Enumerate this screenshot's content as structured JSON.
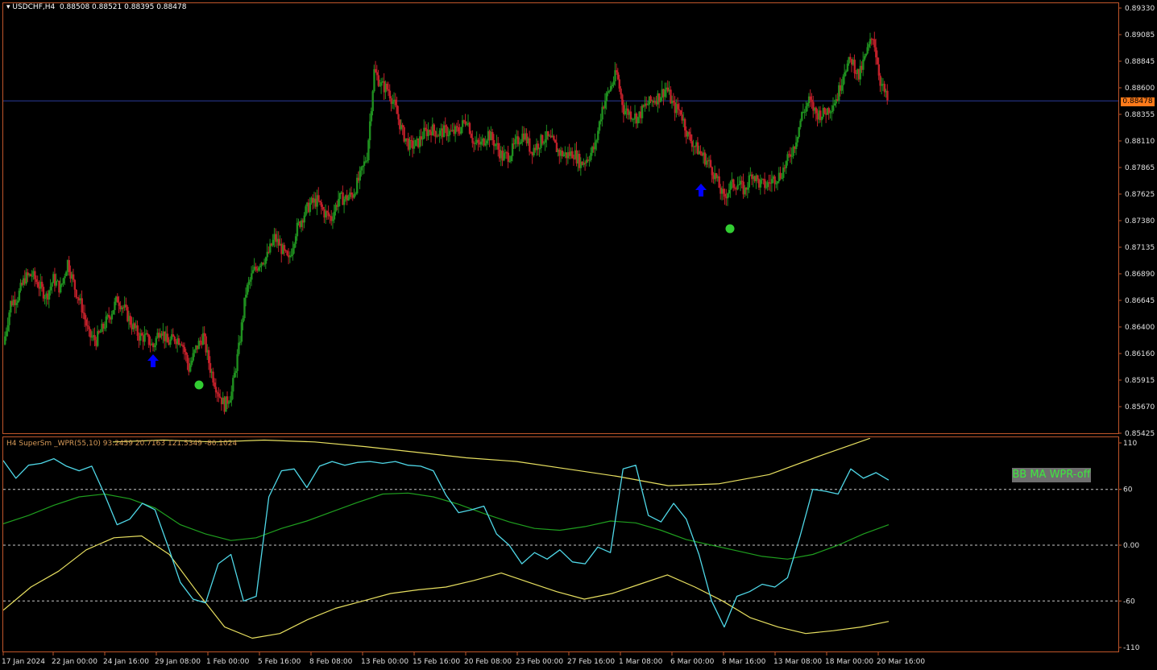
{
  "chart": {
    "symbol_tf": "USDCHF,H4",
    "ohlc": "0.88508 0.88521 0.88395 0.88478",
    "current_price": "0.88478",
    "y_ticks": [
      "0.89330",
      "0.89085",
      "0.88845",
      "0.88600",
      "0.88355",
      "0.88110",
      "0.87865",
      "0.87625",
      "0.87380",
      "0.87135",
      "0.86890",
      "0.86645",
      "0.86400",
      "0.86160",
      "0.85915",
      "0.85670",
      "0.85425"
    ],
    "up_color": "#1f8f1f",
    "down_color": "#c0202a",
    "arrow_color": "#0000ff",
    "dot_color": "#32cd32"
  },
  "indicator": {
    "title": "H4 SuperSm _WPR(55,10) 93.2459 20.7163 121.5349 -80.1024",
    "y_labels": [
      "110",
      "60",
      "0.00",
      "-60",
      "-110"
    ],
    "button_label": "BB MA WPR-off",
    "colors": {
      "wpr": "#4fd8e8",
      "ma": "#1f9f1f",
      "bands": "#e8e060"
    }
  },
  "x_axis": {
    "labels": [
      "17 Jan 2024",
      "22 Jan 00:00",
      "24 Jan 16:00",
      "29 Jan 08:00",
      "1 Feb 00:00",
      "5 Feb 16:00",
      "8 Feb 08:00",
      "13 Feb 00:00",
      "15 Feb 16:00",
      "20 Feb 08:00",
      "23 Feb 00:00",
      "27 Feb 16:00",
      "1 Mar 08:00",
      "6 Mar 00:00",
      "8 Mar 16:00",
      "13 Mar 08:00",
      "18 Mar 00:00",
      "20 Mar 16:00"
    ]
  },
  "chart_data": {
    "type": "candlestick",
    "price_path": [
      0.8624,
      0.8662,
      0.8668,
      0.8685,
      0.8688,
      0.8678,
      0.8668,
      0.8684,
      0.8675,
      0.87,
      0.8676,
      0.8658,
      0.8632,
      0.8628,
      0.864,
      0.8652,
      0.8666,
      0.8656,
      0.8642,
      0.8632,
      0.863,
      0.8622,
      0.864,
      0.8625,
      0.863,
      0.8628,
      0.8602,
      0.862,
      0.8632,
      0.8602,
      0.8582,
      0.8568,
      0.858,
      0.862,
      0.8672,
      0.869,
      0.87,
      0.8705,
      0.8722,
      0.8712,
      0.87,
      0.8728,
      0.8742,
      0.8753,
      0.8756,
      0.8745,
      0.874,
      0.8758,
      0.8758,
      0.8762,
      0.8778,
      0.8798,
      0.8875,
      0.8862,
      0.8858,
      0.884,
      0.8818,
      0.8806,
      0.8808,
      0.8818,
      0.8822,
      0.8818,
      0.882,
      0.8818,
      0.8822,
      0.8832,
      0.8808,
      0.8808,
      0.8818,
      0.8808,
      0.8796,
      0.8798,
      0.881,
      0.8818,
      0.8802,
      0.8808,
      0.8815,
      0.881,
      0.88,
      0.8798,
      0.88,
      0.879,
      0.8796,
      0.8806,
      0.8842,
      0.8858,
      0.8873,
      0.884,
      0.8836,
      0.8832,
      0.8843,
      0.8848,
      0.8852,
      0.886,
      0.8842,
      0.8838,
      0.8816,
      0.8806,
      0.8798,
      0.879,
      0.8776,
      0.8758,
      0.877,
      0.8772,
      0.8765,
      0.8782,
      0.8772,
      0.877,
      0.8776,
      0.878,
      0.8793,
      0.8808,
      0.8835,
      0.8848,
      0.8836,
      0.8836,
      0.8842,
      0.8852,
      0.8878,
      0.8885,
      0.887,
      0.889,
      0.8908,
      0.8866,
      0.8848
    ],
    "signals": {
      "buy_arrows": [
        "26 Jan",
        "7 Mar"
      ],
      "dots": [
        "30 Jan",
        "8 Mar"
      ]
    },
    "indicator": {
      "levels": [
        110,
        60,
        0,
        -60,
        -110
      ],
      "wpr": [
        91,
        72,
        86,
        88,
        93,
        85,
        80,
        85,
        55,
        22,
        28,
        45,
        38,
        0,
        -40,
        -58,
        -62,
        -20,
        -10,
        -60,
        -55,
        52,
        80,
        82,
        62,
        85,
        90,
        86,
        89,
        90,
        88,
        90,
        86,
        85,
        80,
        54,
        35,
        38,
        42,
        12,
        0,
        -20,
        -8,
        -15,
        -5,
        -18,
        -20,
        -2,
        -8,
        82,
        86,
        32,
        25,
        45,
        28,
        -10,
        -60,
        -88,
        -55,
        -50,
        -42,
        -45,
        -35,
        10,
        60,
        58,
        55,
        82,
        72,
        78,
        70
      ],
      "ma": [
        23,
        32,
        43,
        52,
        55,
        50,
        40,
        22,
        12,
        5,
        8,
        18,
        26,
        36,
        46,
        55,
        56,
        52,
        44,
        34,
        25,
        18,
        16,
        20,
        26,
        24,
        16,
        6,
        0,
        -6,
        -12,
        -15,
        -10,
        0,
        12,
        22
      ],
      "upper": [
        111,
        113,
        111,
        113,
        111,
        106,
        100,
        94,
        90,
        82,
        74,
        64,
        66,
        76,
        96,
        115
      ],
      "lower": [
        -70,
        -45,
        -28,
        -5,
        8,
        10,
        -10,
        -50,
        -88,
        -100,
        -95,
        -80,
        -68,
        -60,
        -52,
        -48,
        -45,
        -38,
        -30,
        -40,
        -50,
        -58,
        -52,
        -42,
        -32,
        -45,
        -60,
        -78,
        -88,
        -95,
        -92,
        -88,
        -82
      ]
    }
  }
}
